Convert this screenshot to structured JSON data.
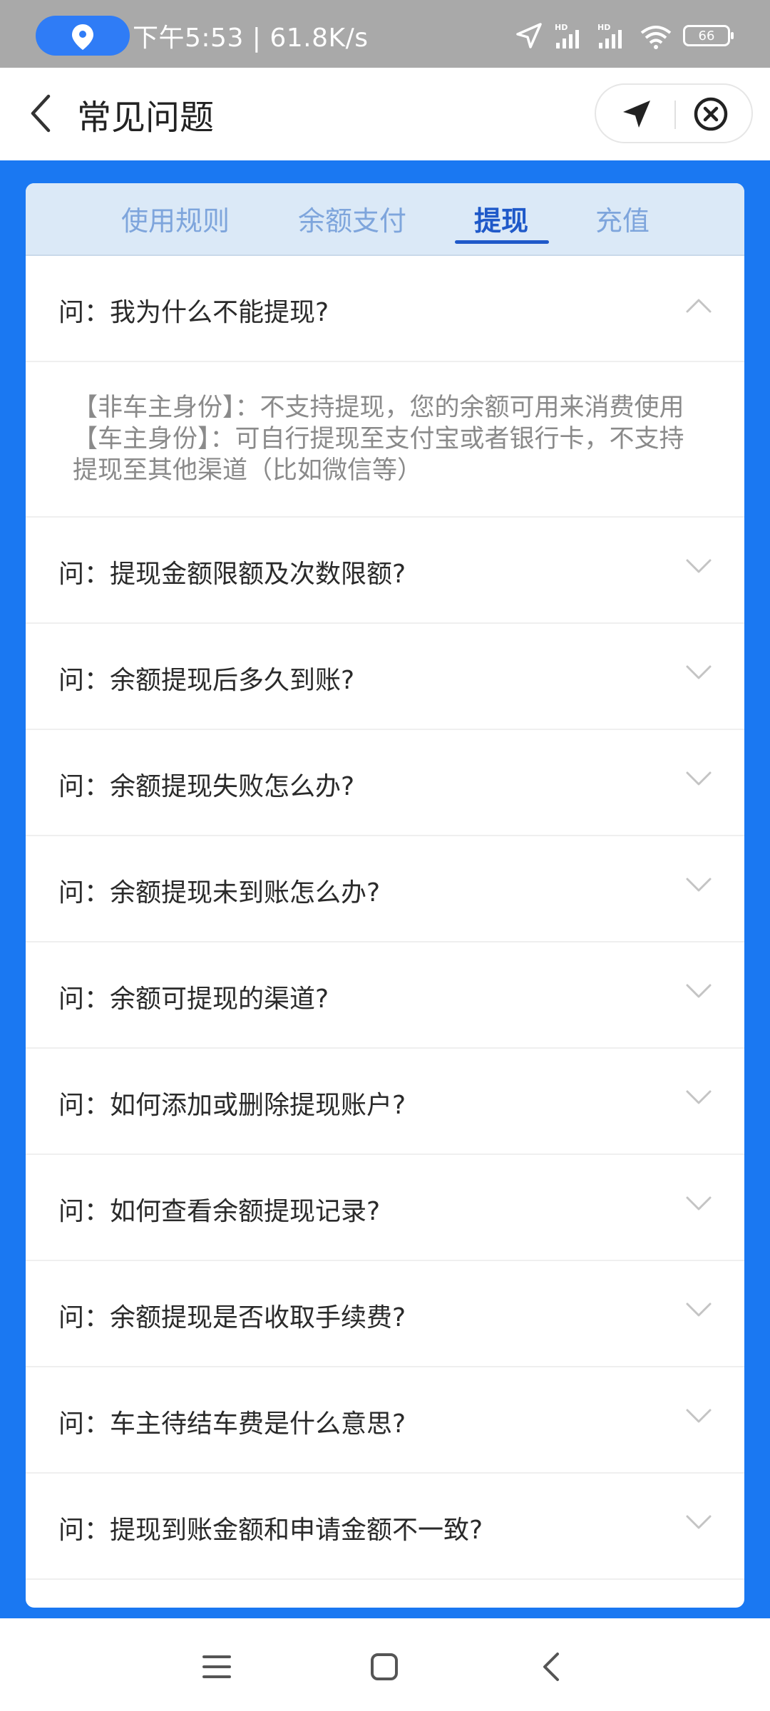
{
  "status_bar": {
    "time_speed": "下午5:53 | 61.8K/s",
    "battery": "66",
    "icons": [
      "location-pin-icon",
      "location-arrow-icon",
      "hd-signal-icon",
      "hd-signal-icon",
      "wifi-icon",
      "battery-icon"
    ]
  },
  "header": {
    "title": "常见问题",
    "back_icon": "chevron-left-icon",
    "capsule_icons": [
      "navigation-arrow-icon",
      "close-circle-icon"
    ]
  },
  "tabs": [
    {
      "label": "使用规则"
    },
    {
      "label": "余额支付"
    },
    {
      "label": "提现"
    },
    {
      "label": "充值"
    }
  ],
  "active_tab": "提现",
  "faq": [
    {
      "question": "问：我为什么不能提现?",
      "expanded": true,
      "answer": [
        "【非车主身份】：不支持提现，您的余额可用来消费使用",
        "【车主身份】：可自行提现至支付宝或者银行卡，不支持提现至其他渠道（比如微信等）"
      ]
    },
    {
      "question": "问：提现金额限额及次数限额?"
    },
    {
      "question": "问：余额提现后多久到账?"
    },
    {
      "question": "问：余额提现失败怎么办?"
    },
    {
      "question": "问：余额提现未到账怎么办?"
    },
    {
      "question": "问：余额可提现的渠道?"
    },
    {
      "question": "问：如何添加或删除提现账户?"
    },
    {
      "question": "问：如何查看余额提现记录?"
    },
    {
      "question": "问：余额提现是否收取手续费?"
    },
    {
      "question": "问：车主待结车费是什么意思?"
    },
    {
      "question": "问：提现到账金额和申请金额不一致?"
    }
  ],
  "colors": {
    "brand_blue": "#1a78f2",
    "tab_active": "#1f59c9",
    "tab_inactive": "#7ea5dc",
    "tab_bar_bg": "#dbe9f7"
  },
  "navbar": {
    "icons": [
      "menu-icon",
      "home-square-icon",
      "back-chevron-icon"
    ]
  }
}
